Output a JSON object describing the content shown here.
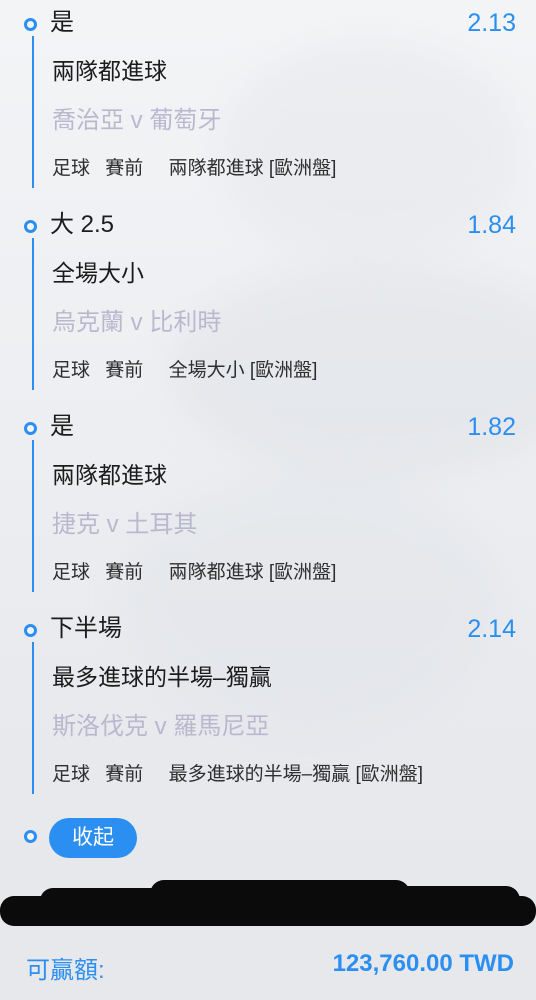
{
  "bets": [
    {
      "selection": "是",
      "odds": "2.13",
      "market": "兩隊都進球",
      "teams": "喬治亞 v 葡萄牙",
      "sport": "足球",
      "phase": "賽前",
      "market_type": "兩隊都進球 [歐洲盤]"
    },
    {
      "selection": "大 2.5",
      "odds": "1.84",
      "market": "全場大小",
      "teams": "烏克蘭 v 比利時",
      "sport": "足球",
      "phase": "賽前",
      "market_type": "全場大小 [歐洲盤]"
    },
    {
      "selection": "是",
      "odds": "1.82",
      "market": "兩隊都進球",
      "teams": "捷克 v 土耳其",
      "sport": "足球",
      "phase": "賽前",
      "market_type": "兩隊都進球 [歐洲盤]"
    },
    {
      "selection": "下半場",
      "odds": "2.14",
      "market": "最多進球的半場–獨贏",
      "teams": "斯洛伐克 v 羅馬尼亞",
      "sport": "足球",
      "phase": "賽前",
      "market_type": "最多進球的半場–獨贏 [歐洲盤]"
    }
  ],
  "collapse_label": "收起",
  "footer": {
    "label": "可贏額:",
    "amount": "123,760.00 TWD"
  },
  "colors": {
    "accent": "#2a8ff0",
    "teams_text": "#b9b8cf",
    "redaction": "#0b0b0b"
  }
}
